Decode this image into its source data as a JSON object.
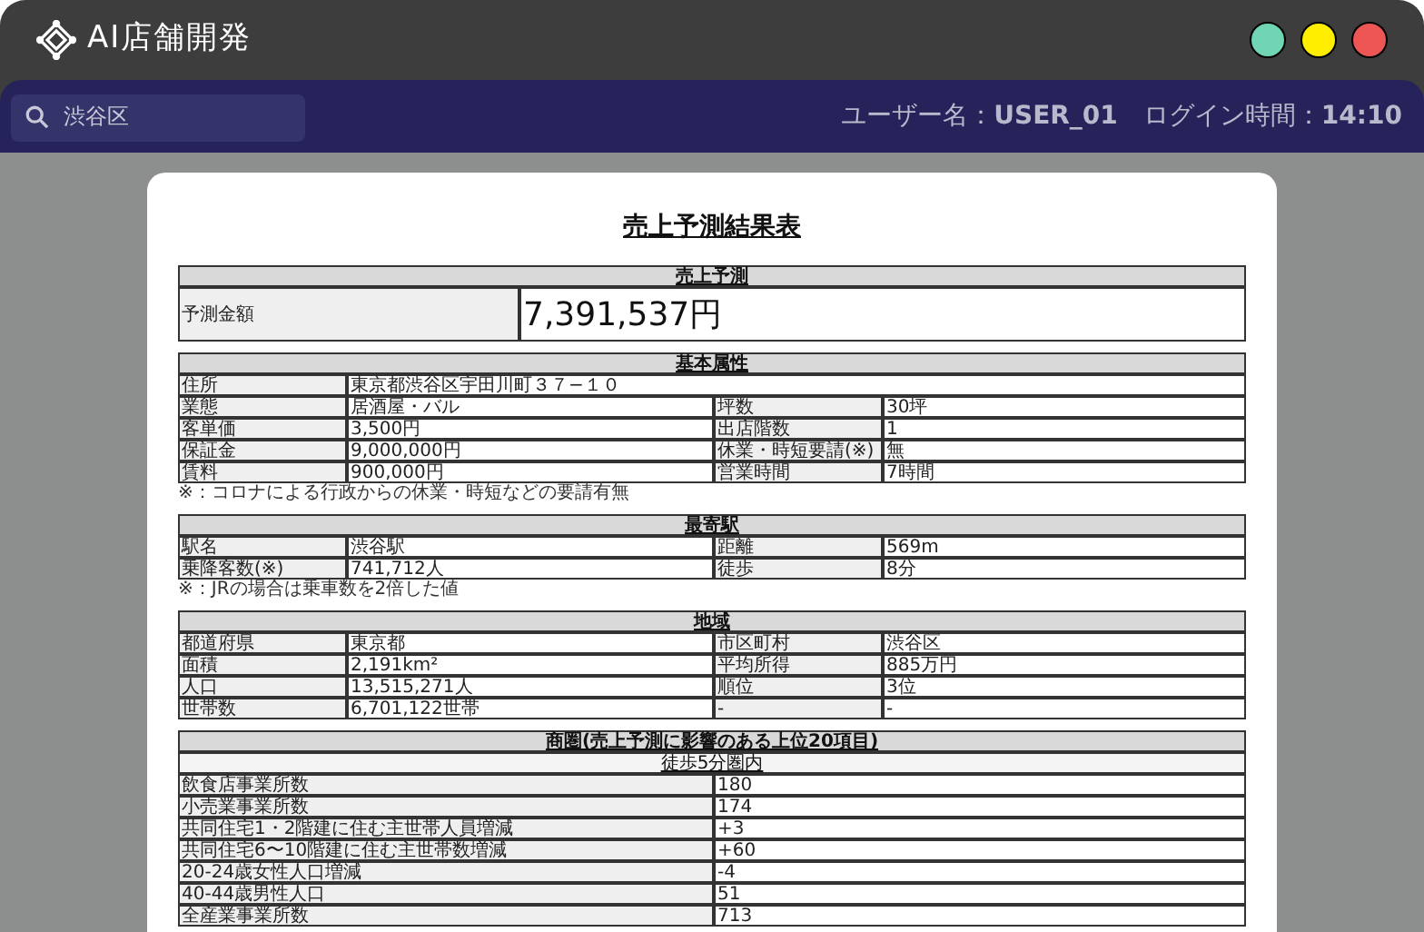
{
  "app": {
    "title": "AI店舗開発"
  },
  "search": {
    "value": "渋谷区"
  },
  "status": [
    {
      "label": "ユーザー名：",
      "value": "USER_01"
    },
    {
      "label": "ログイン時間：",
      "value": "14:10"
    }
  ],
  "report": {
    "title": "売上予測結果表",
    "sections": [
      {
        "kind": "forecast",
        "heading": "売上予測",
        "label": "予測金額",
        "value": "7,391,537円"
      },
      {
        "kind": "grid",
        "heading": "基本属性",
        "rows": [
          [
            "住所",
            "東京都渋谷区宇田川町３７−１０"
          ],
          [
            "業態",
            "居酒屋・バル",
            "坪数",
            "30坪"
          ],
          [
            "客単価",
            "3,500円",
            "出店階数",
            "1"
          ],
          [
            "保証金",
            "9,000,000円",
            "休業・時短要請(※)",
            "無"
          ],
          [
            "賃料",
            "900,000円",
            "営業時間",
            "7時間"
          ]
        ],
        "note": "※：コロナによる行政からの休業・時短などの要請有無"
      },
      {
        "kind": "grid",
        "heading": "最寄駅",
        "rows": [
          [
            "駅名",
            "渋谷駅",
            "距離",
            "569m"
          ],
          [
            "乗降客数(※)",
            "741,712人",
            "徒歩",
            "8分"
          ]
        ],
        "note": "※：JRの場合は乗車数を2倍した値"
      },
      {
        "kind": "grid",
        "heading": "地域",
        "rows": [
          [
            "都道府県",
            "東京都",
            "市区町村",
            "渋谷区"
          ],
          [
            "面積",
            "2,191km²",
            "平均所得",
            "885万円"
          ],
          [
            "人口",
            "13,515,271人",
            "順位",
            "3位"
          ],
          [
            "世帯数",
            "6,701,122世帯",
            "-",
            "-"
          ]
        ]
      },
      {
        "kind": "list",
        "heading": "商圏(売上予測に影響のある上位20項目)",
        "subheading": "徒歩5分圏内",
        "rows": [
          [
            "飲食店事業所数",
            "180"
          ],
          [
            "小売業事業所数",
            "174"
          ],
          [
            "共同住宅1・2階建に住む主世帯人員増減",
            "+3"
          ],
          [
            "共同住宅6〜10階建に住む主世帯数増減",
            "+60"
          ],
          [
            "20-24歳女性人口増減",
            "-4"
          ],
          [
            "40-44歳男性人口",
            "51"
          ],
          [
            "全産業事業所数",
            "713"
          ]
        ]
      }
    ]
  }
}
